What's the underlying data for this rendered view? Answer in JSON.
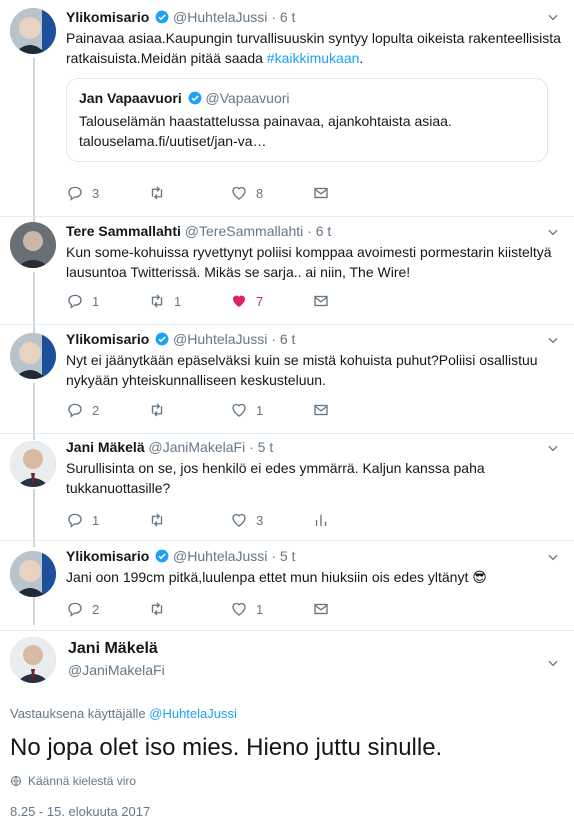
{
  "tweets": [
    {
      "name": "Ylikomisario",
      "handle": "@HuhtelaJussi",
      "time": "6 t",
      "text_before": "Painavaa asiaa.Kaupungin turvallisuuskin syntyy lopulta oikeista rakenteellisista ratkaisuista.Meidän pitää saada ",
      "hashtag": "#kaikkimukaan",
      "text_after": ".",
      "quote": {
        "name": "Jan Vapaavuori",
        "handle": "@Vapaavuori",
        "text": "Talouselämän haastattelussa painavaa, ajankohtaista asiaa.",
        "link": "talouselama.fi/uutiset/jan-va…"
      },
      "replies": "3",
      "retweets": "",
      "likes": "8"
    },
    {
      "name": "Tere Sammallahti",
      "handle": "@TereSammallahti",
      "time": "6 t",
      "text": "Kun some-kohuissa ryvettynyt poliisi komppaa avoimesti pormestarin kiisteltyä lausuntoa Twitterissä. Mikäs se sarja.. ai niin, The Wire!",
      "replies": "1",
      "retweets": "1",
      "likes": "7"
    },
    {
      "name": "Ylikomisario",
      "handle": "@HuhtelaJussi",
      "time": "6 t",
      "text": "Nyt ei jäänytkään epäselväksi kuin se mistä kohuista puhut?Poliisi osallistuu nykyään yhteiskunnalliseen keskusteluun.",
      "replies": "2",
      "retweets": "",
      "likes": "1"
    },
    {
      "name": "Jani Mäkelä",
      "handle": "@JaniMakelaFi",
      "time": "5 t",
      "text": "Surullisinta on se, jos henkilö ei edes ymmärrä. Kaljun kanssa paha tukkanuottasille?",
      "replies": "1",
      "retweets": "",
      "likes": "3"
    },
    {
      "name": "Ylikomisario",
      "handle": "@HuhtelaJussi",
      "time": "5 t",
      "text": "Jani oon 199cm pitkä,luulenpa ettet mun hiuksiin ois edes yltänyt",
      "emoji": "😎",
      "replies": "2",
      "retweets": "",
      "likes": "1"
    }
  ],
  "main_tweet": {
    "name": "Jani Mäkelä",
    "handle": "@JaniMakelaFi",
    "reply_prefix": "Vastauksena käyttäjälle",
    "reply_to": "@HuhtelaJussi",
    "text": "No jopa olet iso mies. Hieno juttu sinulle.",
    "translate": "Käännä kielestä viro",
    "timestamp": "8.25 - 15. elokuuta 2017"
  },
  "separator": "·",
  "colors": {
    "accent": "#1da1f2",
    "like": "#e0245e",
    "muted": "#657786",
    "thread": "#ccd6dd"
  },
  "icons": [
    "reply-icon",
    "retweet-icon",
    "like-icon",
    "message-icon",
    "analytics-icon",
    "chevron-down-icon",
    "verified-icon",
    "globe-icon"
  ]
}
